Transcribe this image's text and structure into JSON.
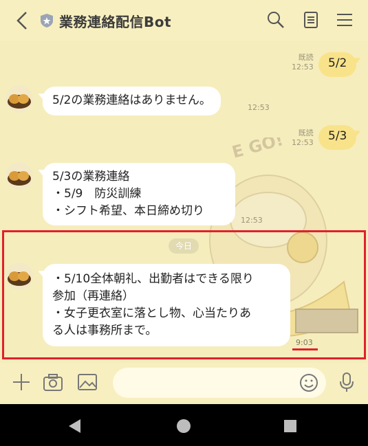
{
  "header": {
    "title": "業務連絡配信Bot",
    "icons": [
      "back-icon",
      "shield-icon",
      "search-icon",
      "notes-icon",
      "menu-icon"
    ]
  },
  "messages": {
    "sent1": {
      "text": "5/2",
      "read": "既読",
      "time": "12:53"
    },
    "recv1": {
      "text": "5/2の業務連絡はありません。",
      "time": "12:53"
    },
    "sent2": {
      "text": "5/3",
      "read": "既読",
      "time": "12:53"
    },
    "recv2": {
      "lines": [
        "5/3の業務連絡",
        "・5/9　防災訓練",
        "・シフト希望、本日締め切り"
      ],
      "time": "12:53"
    },
    "date_separator": "今日",
    "recv3": {
      "lines": [
        "・5/10全体朝礼、出勤者はできる限り",
        "参加（再連絡）",
        "・女子更衣室に落とし物、心当たりあ",
        "る人は事務所まで。"
      ],
      "time": "9:03"
    }
  },
  "input": {
    "placeholder": ""
  },
  "colors": {
    "background": "#f6edbd",
    "sent_bubble": "#f9e38a",
    "highlight": "#e0202c"
  }
}
